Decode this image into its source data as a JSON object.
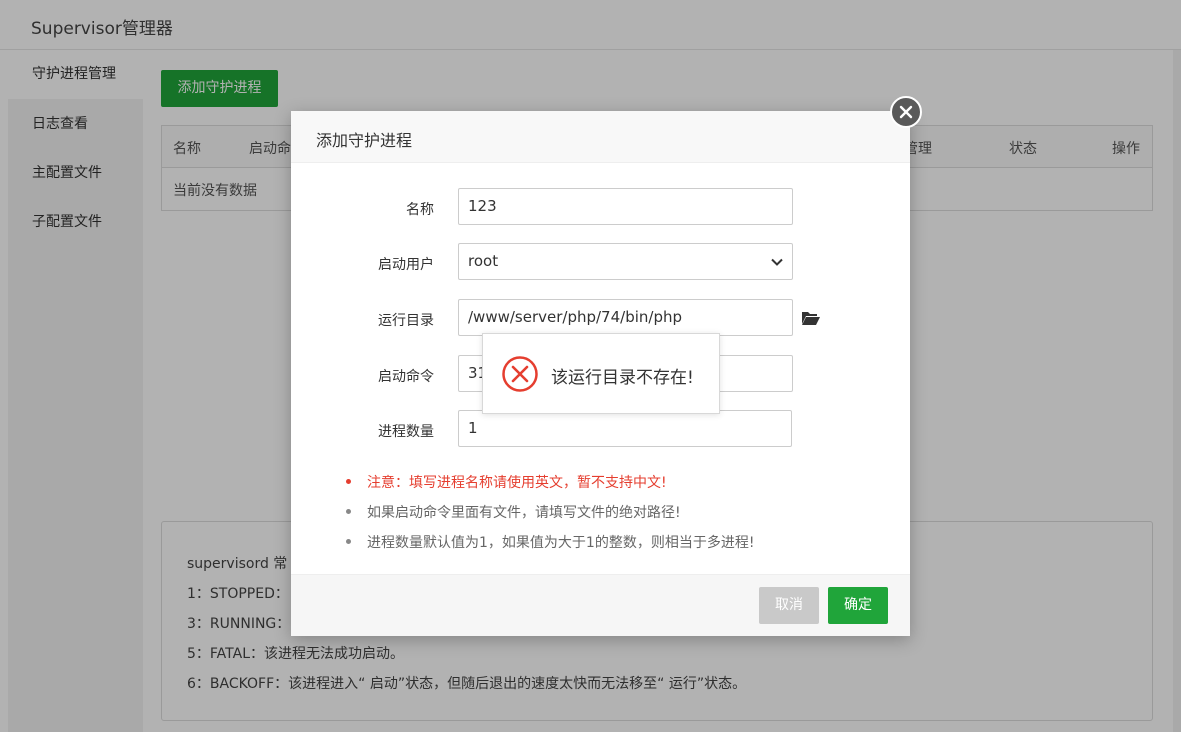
{
  "app": {
    "title": "Supervisor管理器"
  },
  "sidebar": {
    "items": [
      {
        "label": "守护进程管理"
      },
      {
        "label": "日志查看"
      },
      {
        "label": "主配置文件"
      },
      {
        "label": "子配置文件"
      }
    ]
  },
  "main": {
    "add_button": "添加守护进程",
    "table": {
      "headers": [
        "名称",
        "启动命",
        "程管理",
        "状态",
        "操作"
      ],
      "empty_text": "当前没有数据"
    },
    "info": {
      "lines": [
        "supervisord 常",
        "1：STOPPED：",
        "3：RUNNING：",
        "5：FATAL：该进程无法成功启动。",
        "6：BACKOFF：该进程进入“ 启动”状态，但随后退出的速度太快而无法移至“ 运行”状态。"
      ]
    }
  },
  "modal": {
    "title": "添加守护进程",
    "fields": {
      "name": {
        "label": "名称",
        "value": "123"
      },
      "user": {
        "label": "启动用户",
        "value": "root"
      },
      "dir": {
        "label": "运行目录",
        "value": "/www/server/php/74/bin/php"
      },
      "cmd": {
        "label": "启动命令",
        "value": "31"
      },
      "count": {
        "label": "进程数量",
        "value": "1"
      }
    },
    "notes": [
      "注意：填写进程名称请使用英文，暂不支持中文!",
      "如果启动命令里面有文件，请填写文件的绝对路径!",
      "进程数量默认值为1，如果值为大于1的整数，则相当于多进程!"
    ],
    "cancel": "取消",
    "confirm": "确定"
  },
  "toast": {
    "message": "该运行目录不存在!"
  },
  "colors": {
    "primary": "#20a53a",
    "error": "#e53e2f"
  }
}
